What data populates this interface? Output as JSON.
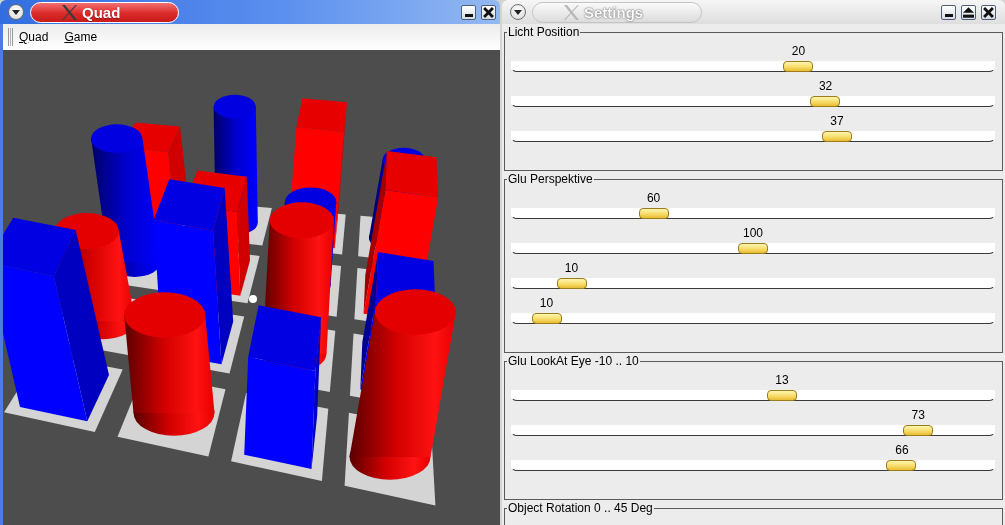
{
  "windows": [
    {
      "kind": "scene",
      "title": "Quad",
      "active": true,
      "title_buttons": [
        {
          "kind": "minimize"
        },
        {
          "kind": "close"
        }
      ],
      "menu": [
        "Quad",
        "Game"
      ]
    },
    {
      "kind": "settings",
      "title": "Settings",
      "active": false,
      "title_buttons": [
        {
          "kind": "minimize"
        },
        {
          "kind": "shade"
        },
        {
          "kind": "close"
        }
      ],
      "groups": [
        {
          "title": "Licht Position",
          "sliders": [
            {
              "value": "20",
              "level": 0.6
            },
            {
              "value": "32",
              "level": 0.66
            },
            {
              "value": "37",
              "level": 0.685
            }
          ]
        },
        {
          "title": "Glu Perspektive",
          "sliders": [
            {
              "value": "60",
              "level": 0.281
            },
            {
              "value": "100",
              "level": 0.5
            },
            {
              "value": "10",
              "level": 0.1
            },
            {
              "value": "10",
              "level": 0.045
            }
          ]
        },
        {
          "title": "Glu LookAt Eye -10 .. 10",
          "sliders": [
            {
              "value": "13",
              "level": 0.564
            },
            {
              "value": "73",
              "level": 0.864
            },
            {
              "value": "66",
              "level": 0.828
            }
          ]
        },
        {
          "title": "Object Rotation 0 .. 45 Deg"
        }
      ]
    }
  ]
}
